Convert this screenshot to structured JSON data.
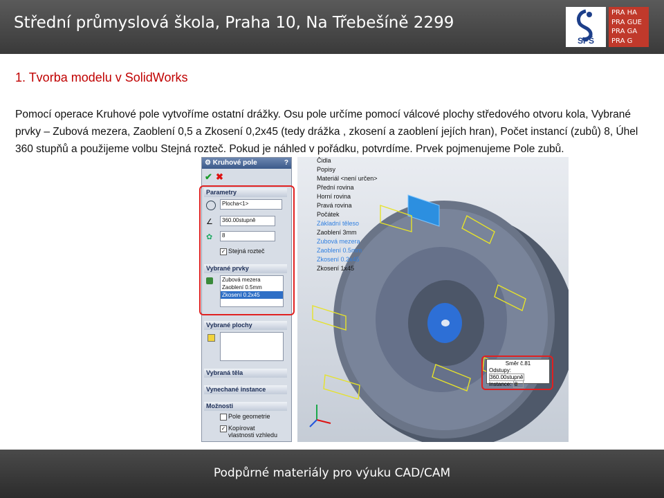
{
  "header": {
    "title": "Střední průmyslová škola, Praha 10, Na Třebešíně 2299",
    "logo_sps": "SPŠ",
    "logo_praha": [
      "PRA HA",
      "PRA GUE",
      "PRA GA",
      "PRA G"
    ]
  },
  "heading": "1. Tvorba modelu v SolidWorks",
  "body_text": "Pomocí operace Kruhové pole vytvoříme ostatní drážky. Osu pole určíme pomocí válcové plochy středového otvoru kola, Vybrané prvky – Zubová mezera, Zaoblení 0,5 a Zkosení 0,2x45 (tedy drážka , zkosení a zaoblení jejích hran), Počet instancí (zubů) 8, Úhel 360 stupňů a použijeme volbu Stejná rozteč. Pokud je náhled v pořádku, potvrdíme. Prvek pojmenujeme Pole zubů.",
  "property_manager": {
    "title": "Kruhové pole",
    "help": "?",
    "parameters_label": "Parametry",
    "axis_value": "Plocha<1>",
    "angle_value": "360.00stupně",
    "instances_value": "8",
    "equal_spacing_label": "Stejná rozteč",
    "selected_features_label": "Vybrané prvky",
    "selected_features": [
      "Zubová mezera",
      "Zaoblení 0.5mm",
      "Zkosení 0.2x45"
    ],
    "selected_faces_label": "Vybrané plochy",
    "selected_bodies_label": "Vybraná těla",
    "skipped_instances_label": "Vynechané instance",
    "options_label": "Možnosti",
    "geometry_pattern_label": "Pole geometrie",
    "propagate_label": "Kopírovat vlastnosti vzhledu"
  },
  "feature_tree": [
    "Čidla",
    "Popisy",
    "Materiál <není určen>",
    "Přední rovina",
    "Horní rovina",
    "Pravá rovina",
    "Počátek",
    "Základní těleso",
    "Zaoblení 3mm",
    "Zubová mezera",
    "Zaoblení 0.5mm",
    "Zkosení 0.2x45",
    "Zkosení 1x45"
  ],
  "callout": {
    "title": "Směr č.81",
    "spacing_label": "Odstupy:",
    "spacing_value": "360.00stupně",
    "instance_label": "Instance:",
    "instance_value": "8"
  },
  "footer": "Podpůrné materiály pro výuku CAD/CAM",
  "colors": {
    "heading": "#c00000",
    "accent_red": "#e02020",
    "wheel": "#5c6778"
  }
}
